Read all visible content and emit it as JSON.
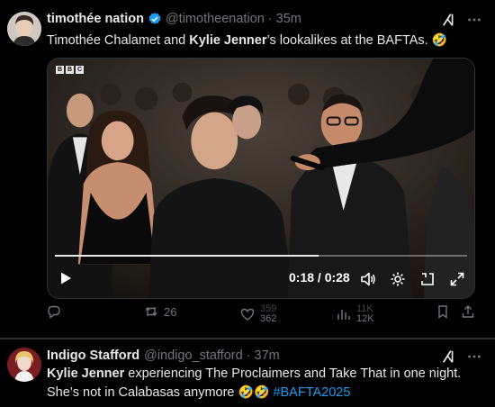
{
  "colors": {
    "background": "#000000",
    "text": "#e7e9ea",
    "muted": "#71767b",
    "accent": "#1d9bf0",
    "border": "#2f3336"
  },
  "tweets": [
    {
      "display_name": "timothée nation",
      "handle": "@timotheenation",
      "separator": "·",
      "time": "35m",
      "verified": true,
      "text_parts": [
        "Timothée Chalamet and ",
        "Kylie Jenner",
        "’s lookalikes at the BAFTAs. ",
        "🤣"
      ],
      "media": {
        "watermark": [
          "B",
          "B",
          "C"
        ],
        "time_readout": "0:18 / 0:28",
        "progress": 0.64,
        "controls": [
          "play-icon",
          "volume-icon",
          "settings-icon",
          "exit-fullscreen-icon",
          "expand-icon"
        ]
      },
      "actions": {
        "reply": {
          "icon": "reply-icon",
          "count": ""
        },
        "repost": {
          "icon": "repost-icon",
          "count": "26"
        },
        "like": {
          "icon": "heart-icon",
          "count_old": "359",
          "count_new": "362"
        },
        "views": {
          "icon": "views-icon",
          "count_old": "11K",
          "count_new": "12K"
        },
        "bookmark": {
          "icon": "bookmark-icon"
        },
        "share": {
          "icon": "share-icon"
        }
      }
    },
    {
      "display_name": "Indigo Stafford",
      "handle": "@indigo_stafford",
      "separator": "·",
      "time": "37m",
      "verified": false,
      "text_line1_parts": [
        "Kylie Jenner",
        " experiencing The Proclaimers and Take That in one night."
      ],
      "text_line2_parts": [
        "She’s not in Calabasas anymore ",
        "🤣🤣",
        " ",
        "#BAFTA2025"
      ]
    }
  ]
}
